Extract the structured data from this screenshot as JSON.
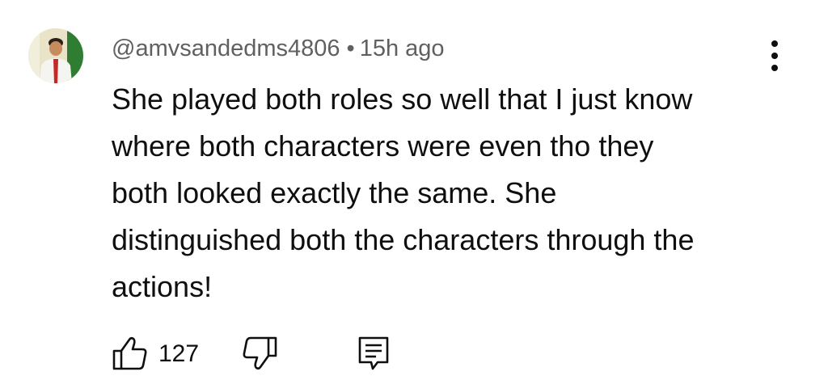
{
  "comment": {
    "author": "@amvsandedms4806",
    "separator": "•",
    "timestamp": "15h ago",
    "lines": [
      "She played both roles so well that I just know",
      "where both characters were even tho they",
      "both looked exactly the same. She",
      "distinguished both the characters through the",
      "actions!"
    ],
    "like_count": "127"
  },
  "icons": {
    "avatar": "user-avatar",
    "menu": "more-vert-icon",
    "like": "thumbs-up-icon",
    "dislike": "thumbs-down-icon",
    "reply": "comment-reply-icon"
  },
  "colors": {
    "text": "#0f0f0f",
    "meta": "#606060",
    "background": "#ffffff"
  }
}
